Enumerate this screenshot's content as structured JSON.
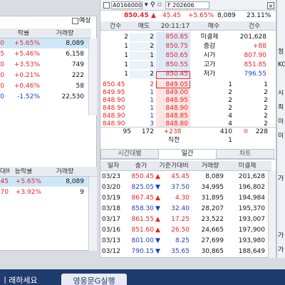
{
  "topbar": {
    "yesang_label": "예상",
    "code": "A0166000",
    "futures": "F 202606"
  },
  "summary": {
    "price": "850.45",
    "change": "45.45",
    "rate": "+5.65%",
    "volume": "8,089",
    "pct": "23.11%"
  },
  "left_table1": {
    "headers": [
      "락률",
      "거래량"
    ],
    "rows": [
      {
        "a": "0",
        "rate": "+5.65%",
        "vol": "8,089",
        "hl": true
      },
      {
        "a": "5",
        "rate": "+5.46%",
        "vol": "6,158"
      },
      {
        "a": "0",
        "rate": "+3.53%",
        "vol": "749"
      },
      {
        "a": "0",
        "rate": "+0.21%",
        "vol": "222"
      },
      {
        "a": "0",
        "rate": "+0.46%",
        "vol": "58"
      },
      {
        "a": "0",
        "rate": "-1.52%",
        "vol": "22,530"
      }
    ]
  },
  "left_table2": {
    "headers": [
      "대비",
      "등락률",
      "거래량"
    ],
    "rows": [
      {
        "a": "45",
        "rate": "+5.65%",
        "vol": "8,089",
        "hl": true
      },
      {
        "a": "70",
        "rate": "+3.92%",
        "vol": "9"
      }
    ]
  },
  "orderbook": {
    "headers": [
      "건수",
      "매도",
      "20:11:17",
      "매수",
      "건수"
    ],
    "ask_rows": [
      {
        "cnt": "2",
        "qty": "2",
        "price": "850.85"
      },
      {
        "cnt": "1",
        "qty": "2",
        "price": "850.75"
      },
      {
        "cnt": "1",
        "qty": "1",
        "price": "850.65"
      },
      {
        "cnt": "1",
        "qty": "1",
        "price": "850.55"
      },
      {
        "cnt": "1",
        "qty": "2",
        "price": "850.45"
      }
    ],
    "info": [
      {
        "label": "미결제",
        "value": "201,628",
        "color": ""
      },
      {
        "label": "증감",
        "value": "+88",
        "color": "red"
      },
      {
        "label": "시가",
        "value": "807.90",
        "color": "red"
      },
      {
        "label": "고가",
        "value": "851.85",
        "color": "red"
      },
      {
        "label": "저가",
        "value": "796.55",
        "color": "blue"
      }
    ],
    "bid_rows": [
      {
        "price": "849.05",
        "qty": "1",
        "cnt": "1"
      },
      {
        "price": "849.00",
        "qty": "2",
        "cnt": "2"
      },
      {
        "price": "848.95",
        "qty": "2",
        "cnt": "2"
      },
      {
        "price": "848.90",
        "qty": "2",
        "cnt": "2"
      },
      {
        "price": "848.85",
        "qty": "4",
        "cnt": "2"
      },
      {
        "price": "848.80",
        "qty": "4",
        "cnt": "2"
      }
    ],
    "trades": [
      {
        "price": "850.45",
        "qty": "2"
      },
      {
        "price": "849.95",
        "qty": "1"
      },
      {
        "price": "848.90",
        "qty": "1"
      },
      {
        "price": "848.90",
        "qty": "1"
      },
      {
        "price": "848.90",
        "qty": "1"
      },
      {
        "price": "848.90",
        "qty": "3"
      }
    ],
    "totals": {
      "left1": "95",
      "left2": "172",
      "mid": "+238",
      "right1": "410",
      "right2": "228"
    },
    "after": {
      "label": "직전",
      "value": "1"
    }
  },
  "tabs": [
    "시간대별",
    "일간",
    "차트"
  ],
  "daily": {
    "headers": [
      "일자",
      "종가",
      "기준가대비",
      "거래량",
      "미결제"
    ],
    "rows": [
      {
        "date": "03/23",
        "close": "850.45",
        "dir": "up",
        "diff": "45.45",
        "vol": "8,089",
        "oi": "201,628"
      },
      {
        "date": "03/20",
        "close": "825.05",
        "dir": "down",
        "diff": "37.50",
        "vol": "34,995",
        "oi": "196,802"
      },
      {
        "date": "03/19",
        "close": "867.45",
        "dir": "up",
        "diff": "4.30",
        "vol": "31,895",
        "oi": "194,984"
      },
      {
        "date": "03/18",
        "close": "858.30",
        "dir": "down",
        "diff": "32.40",
        "vol": "28,207",
        "oi": "195,370"
      },
      {
        "date": "03/17",
        "close": "861.55",
        "dir": "up",
        "diff": "17.25",
        "vol": "23,522",
        "oi": "193,007"
      },
      {
        "date": "03/16",
        "close": "851.60",
        "dir": "up",
        "diff": "26.50",
        "vol": "24,665",
        "oi": "197,900"
      },
      {
        "date": "03/13",
        "close": "801.00",
        "dir": "down",
        "diff": "8.25",
        "vol": "27,699",
        "oi": "193,980"
      },
      {
        "date": "03/12",
        "close": "790.15",
        "dir": "down",
        "diff": "35.65",
        "vol": "30,865",
        "oi": "188,649"
      }
    ]
  },
  "right_strip": [
    "정",
    "KO",
    "시",
    "최",
    "이",
    "이",
    "가",
    "가",
    "가"
  ],
  "banner": {
    "left_text": "ㅣ래하세요",
    "button": "영웅문G실행"
  },
  "colors": {
    "up": "#e8232a",
    "down": "#1c3ccd",
    "ask_bg": "#dceaf7",
    "bid_bg": "#fbe4e1",
    "banner": "#1f3c6e"
  }
}
